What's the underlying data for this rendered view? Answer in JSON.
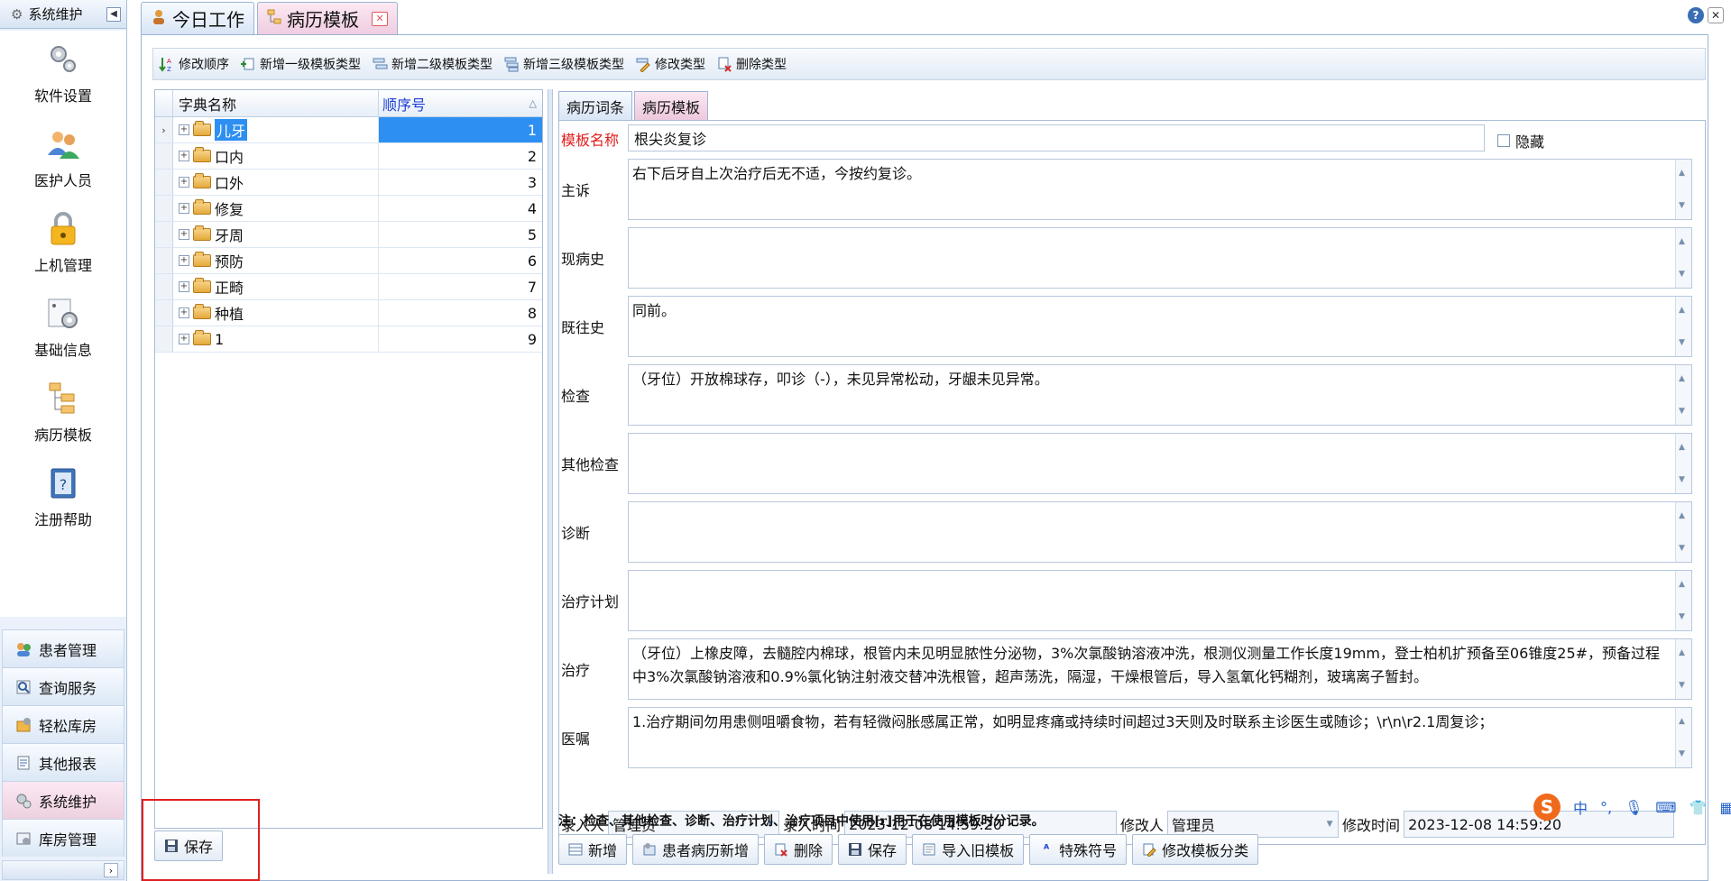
{
  "nav": {
    "header_label": "系统维护",
    "items": [
      {
        "label": "软件设置",
        "icon": "gears-icon"
      },
      {
        "label": "医护人员",
        "icon": "users-icon"
      },
      {
        "label": "上机管理",
        "icon": "lock-icon"
      },
      {
        "label": "基础信息",
        "icon": "settings-panel-icon"
      },
      {
        "label": "病历模板",
        "icon": "template-tree-icon"
      },
      {
        "label": "注册帮助",
        "icon": "help-book-icon"
      }
    ],
    "bottom": [
      {
        "label": "患者管理",
        "icon": "patients-icon"
      },
      {
        "label": "查询服务",
        "icon": "search-icon"
      },
      {
        "label": "轻松库房",
        "icon": "warehouse-icon"
      },
      {
        "label": "其他报表",
        "icon": "report-icon"
      },
      {
        "label": "系统维护",
        "icon": "gear-icon",
        "active": true
      },
      {
        "label": "库房管理",
        "icon": "inventory-icon"
      }
    ]
  },
  "doc_tabs": [
    {
      "label": "今日工作"
    },
    {
      "label": "病历模板",
      "active": true
    }
  ],
  "toolbar": {
    "reorder": "修改顺序",
    "add_level1": "新增一级模板类型",
    "add_level2": "新增二级模板类型",
    "add_level3": "新增三级模板类型",
    "edit_type": "修改类型",
    "delete_type": "删除类型"
  },
  "tree": {
    "col_name": "字典名称",
    "col_order": "顺序号",
    "rows": [
      {
        "name": "儿牙",
        "order": "1",
        "selected": true
      },
      {
        "name": "口内",
        "order": "2"
      },
      {
        "name": "口外",
        "order": "3"
      },
      {
        "name": "修复",
        "order": "4"
      },
      {
        "name": "牙周",
        "order": "5"
      },
      {
        "name": "预防",
        "order": "6"
      },
      {
        "name": "正畸",
        "order": "7"
      },
      {
        "name": "种植",
        "order": "8"
      },
      {
        "name": "1",
        "order": "9"
      }
    ],
    "save_label": "保存"
  },
  "inner_tabs": [
    {
      "label": "病历词条"
    },
    {
      "label": "病历模板",
      "active": true
    }
  ],
  "form": {
    "name_label": "模板名称",
    "name_value": "根尖炎复诊",
    "hidden_label": "隐藏",
    "fields": [
      {
        "label": "主诉",
        "value": "右下后牙自上次治疗后无不适，今按约复诊。"
      },
      {
        "label": "现病史",
        "value": ""
      },
      {
        "label": "既往史",
        "value": "同前。"
      },
      {
        "label": "检查",
        "value": "（牙位）开放棉球存，叩诊（-），未见异常松动，牙龈未见异常。"
      },
      {
        "label": "其他检查",
        "value": ""
      },
      {
        "label": "诊断",
        "value": ""
      },
      {
        "label": "治疗计划",
        "value": ""
      },
      {
        "label": "治疗",
        "value": "（牙位）上橡皮障，去髓腔内棉球，根管内未见明显脓性分泌物，3%次氯酸钠溶液冲洗，根测仪测量工作长度19mm，登士柏机扩预备至06锥度25#，预备过程中3%次氯酸钠溶液和0.9%氯化钠注射液交替冲洗根管，超声荡洗，隔湿，干燥根管后，导入氢氧化钙糊剂，玻璃离子暂封。"
      },
      {
        "label": "医嘱",
        "value": "1.治疗期间勿用患侧咀嚼食物，若有轻微闷胀感属正常，如明显疼痛或持续时间超过3天则及时联系主诊医生或随诊；\\r\\n\\r2.1周复诊；"
      }
    ],
    "entered_by_label": "录入人",
    "entered_by": "管理员",
    "entered_time_label": "录入时间",
    "entered_time": "2023-12-08 14:59:20",
    "modified_by_label": "修改人",
    "modified_by": "管理员",
    "modified_time_label": "修改时间",
    "modified_time": "2023-12-08 14:59:20"
  },
  "note": "注：检查、其他检查、诊断、治疗计划、治疗项目中使用[r]用于在使用模板时分记录。",
  "bottom_buttons": {
    "add": "新增",
    "patient_add": "患者病历新增",
    "delete": "删除",
    "save": "保存",
    "import": "导入旧模板",
    "special": "特殊符号",
    "change_category": "修改模板分类"
  },
  "ime": {
    "logo": "S",
    "lang": "中",
    "punct": "°,"
  },
  "colors": {
    "accent": "#2d8ff1",
    "required_label": "#e21b1b",
    "header_link": "#1d3fd6",
    "highlight_box": "#e02020"
  }
}
